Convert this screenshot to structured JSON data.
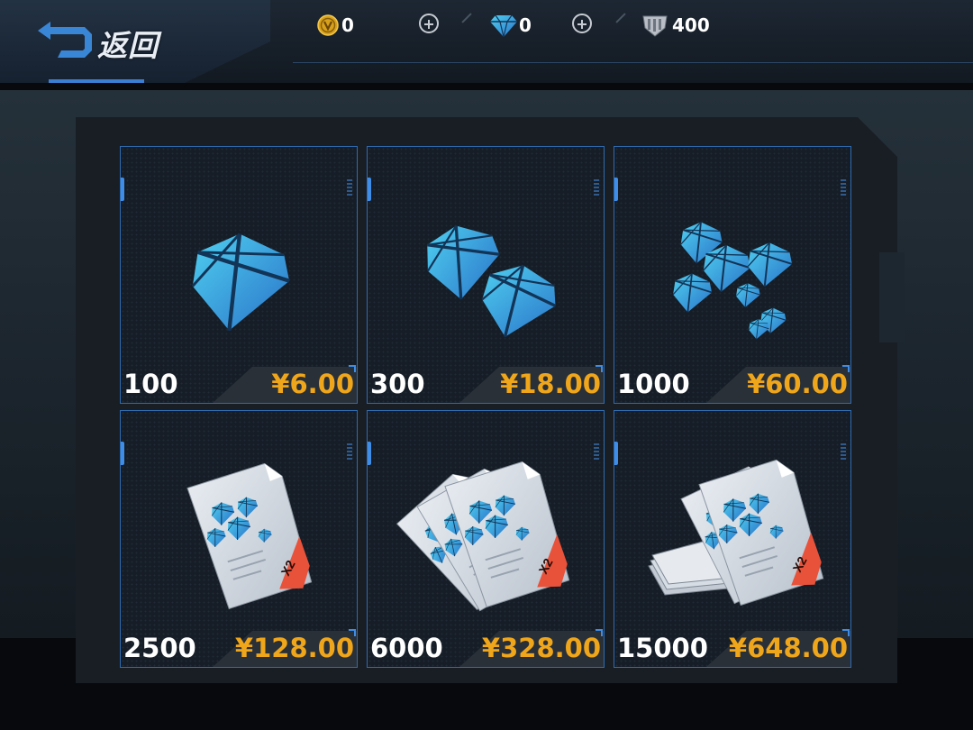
{
  "header": {
    "back_label": "返回",
    "currencies": [
      {
        "name": "coin",
        "icon": "gold-coin-icon",
        "value": "0"
      },
      {
        "name": "diamond",
        "icon": "diamond-icon",
        "value": "0"
      },
      {
        "name": "honor",
        "icon": "shield-badge-icon",
        "value": "400"
      }
    ]
  },
  "shop": {
    "items": [
      {
        "amount": "100",
        "price": "¥6.00",
        "icon": "single-diamond-icon"
      },
      {
        "amount": "300",
        "price": "¥18.00",
        "icon": "two-diamonds-icon"
      },
      {
        "amount": "1000",
        "price": "¥60.00",
        "icon": "diamond-pile-icon"
      },
      {
        "amount": "2500",
        "price": "¥128.00",
        "icon": "diamond-voucher-icon",
        "badge": "X2"
      },
      {
        "amount": "6000",
        "price": "¥328.00",
        "icon": "voucher-fan-icon",
        "badge": "X2"
      },
      {
        "amount": "15000",
        "price": "¥648.00",
        "icon": "voucher-stack-icon",
        "badge": "X2"
      }
    ]
  },
  "colors": {
    "price": "#f0a61a",
    "card_border": "#2f6bb0",
    "diamond": "#3aa7e0",
    "accent": "#3c7fd2"
  }
}
